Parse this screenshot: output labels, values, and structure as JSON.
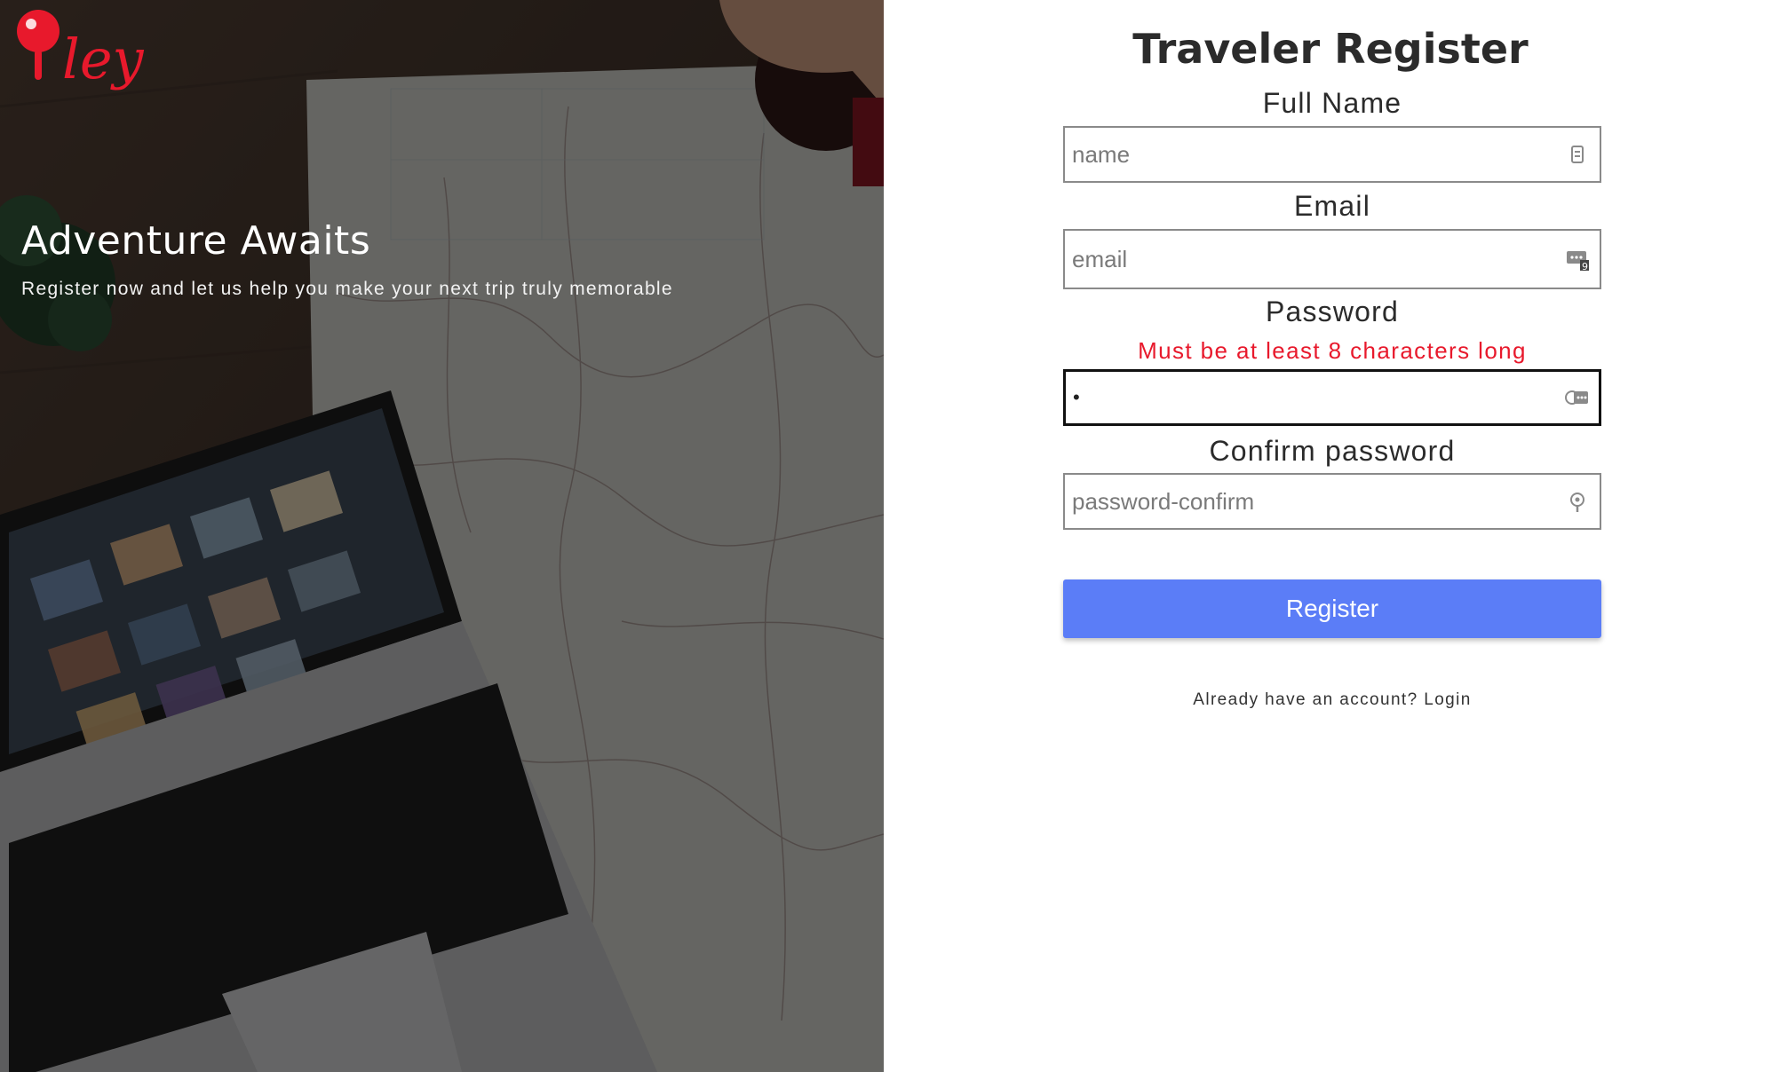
{
  "brand": {
    "logo_text": "ley",
    "accent_color": "#e8192c"
  },
  "hero": {
    "title": "Adventure Awaits",
    "subtitle": "Register now and let us help you make your next trip truly memorable"
  },
  "form": {
    "title": "Traveler Register",
    "fields": {
      "name": {
        "label": "Full Name",
        "placeholder": "name",
        "value": "",
        "icon": "contact-card-icon"
      },
      "email": {
        "label": "Email",
        "placeholder": "email",
        "value": "",
        "icon": "password-manager-icon"
      },
      "password": {
        "label": "Password",
        "error": "Must be at least 8 characters long",
        "placeholder": "",
        "value": "•",
        "icon": "password-manager-icon"
      },
      "password_confirm": {
        "label": "Confirm password",
        "placeholder": "password-confirm",
        "value": "",
        "icon": "key-icon"
      }
    },
    "register_button": "Register",
    "login_prompt": "Already have an account?",
    "login_link": "Login",
    "button_color": "#5b7df7",
    "error_color": "#e8192c"
  }
}
